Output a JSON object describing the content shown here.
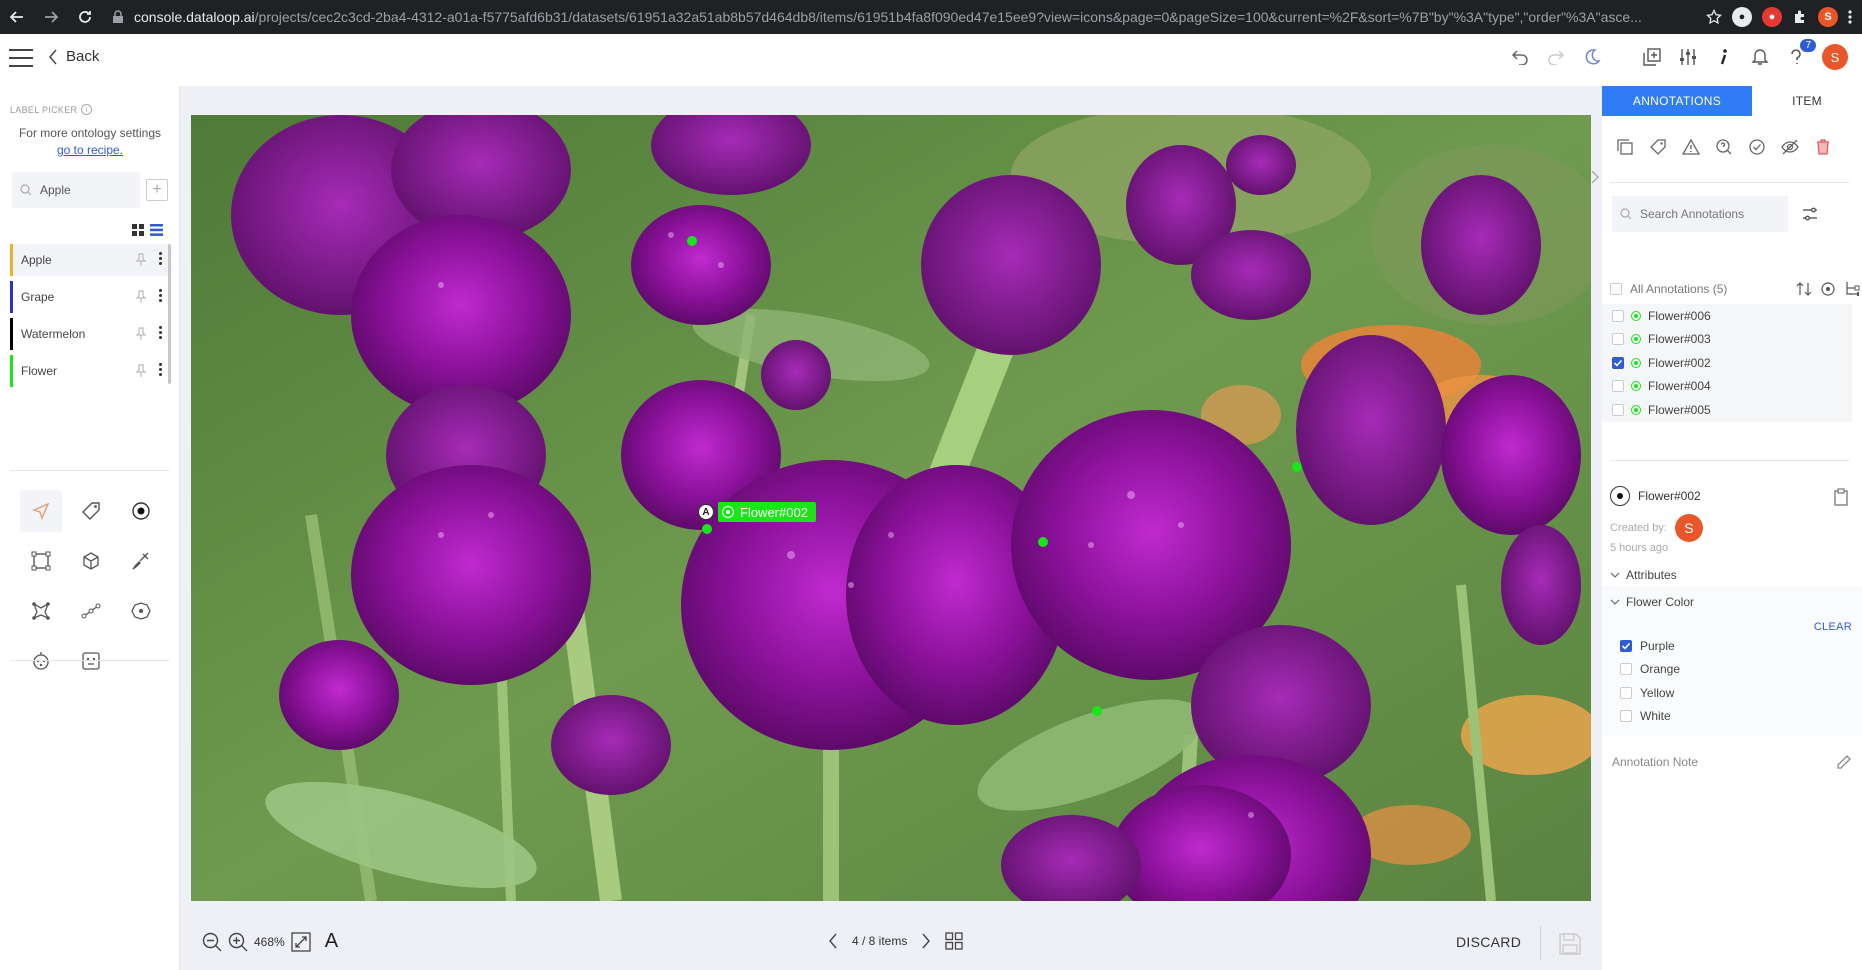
{
  "browser": {
    "url_host": "console.dataloop.ai",
    "url_path": "/projects/cec2c3cd-2ba4-4312-a01a-f5775afd6b31/datasets/61951a32a51ab8b57d464db8/items/61951b4fa8f090ed47e15ee9?view=icons&page=0&pageSize=100&current=%2F&sort=%7B\"by\"%3A\"type\",\"order\"%3A\"asce...",
    "profile_initial": "S"
  },
  "header": {
    "back_label": "Back",
    "help_badge": "7",
    "avatar_initial": "S"
  },
  "left_panel": {
    "title": "LABEL PICKER",
    "more_settings": "For more ontology settings",
    "recipe_link": "go to recipe.",
    "search_value": "Apple",
    "labels": [
      {
        "name": "Apple",
        "color": "#e8b430"
      },
      {
        "name": "Grape",
        "color": "#2433c9"
      },
      {
        "name": "Watermelon",
        "color": "#000000"
      },
      {
        "name": "Flower",
        "color": "#19e619"
      }
    ],
    "tools": [
      "pointer-icon",
      "tag-icon",
      "point-icon",
      "box-icon",
      "cube-icon",
      "brush-icon",
      "polygon-icon",
      "polyline-icon",
      "semantic-icon",
      "pose-icon",
      "face-icon"
    ]
  },
  "canvas": {
    "annotation_label": "Flower#002",
    "annotation_badge": "A",
    "zoom": "468%",
    "text_tool": "A",
    "pager": "4 / 8 items",
    "discard": "DISCARD"
  },
  "right_panel": {
    "tab_annotations": "ANNOTATIONS",
    "tab_item": "ITEM",
    "search_placeholder": "Search Annotations",
    "all_annotations": "All Annotations (5)",
    "annotations": [
      {
        "name": "Flower#006",
        "checked": false
      },
      {
        "name": "Flower#003",
        "checked": false
      },
      {
        "name": "Flower#002",
        "checked": true
      },
      {
        "name": "Flower#004",
        "checked": false
      },
      {
        "name": "Flower#005",
        "checked": false
      }
    ],
    "selected": {
      "name": "Flower#002",
      "created_by": "Created by:",
      "creator_initial": "S",
      "time_ago": "5 hours ago"
    },
    "attributes_label": "Attributes",
    "flower_color_label": "Flower Color",
    "clear": "CLEAR",
    "options": [
      {
        "label": "Purple",
        "checked": true
      },
      {
        "label": "Orange",
        "checked": false
      },
      {
        "label": "Yellow",
        "checked": false
      },
      {
        "label": "White",
        "checked": false
      }
    ],
    "note_label": "Annotation Note"
  },
  "colors": {
    "accent": "#2f7cf6",
    "link": "#2f5bd3",
    "annotation": "#19e619",
    "avatar": "#e8562a"
  }
}
